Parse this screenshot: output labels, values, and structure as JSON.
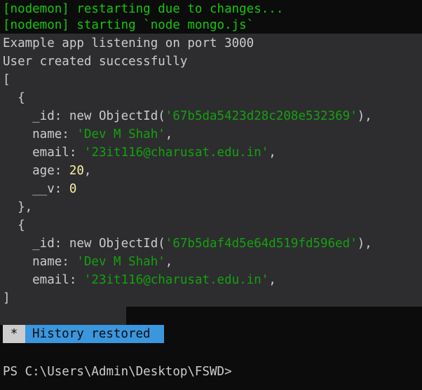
{
  "nodemon": {
    "restart": "[nodemon] restarting due to changes...",
    "start": "[nodemon] starting `node mongo.js`"
  },
  "output": {
    "listening": "Example app listening on port 3000",
    "created": "User created successfully",
    "open_bracket": "[",
    "close_bracket": "]",
    "docs": [
      {
        "open": "  {",
        "id_key": "    _id: new ObjectId(",
        "id_val": "'67b5da5423d28c208e532369'",
        "id_end": "),",
        "name_key": "    name: ",
        "name_val": "'Dev M Shah'",
        "email_key": "    email: ",
        "email_val": "'23it116@charusat.edu.in'",
        "age_key": "    age: ",
        "age_val": "20",
        "v_key": "    __v: ",
        "v_val": "0",
        "close": "  },"
      },
      {
        "open": "  {",
        "id_key": "    _id: new ObjectId(",
        "id_val": "'67b5daf4d5e64d519fd596ed'",
        "id_end": "),",
        "name_key": "    name: ",
        "name_val": "'Dev M Shah'",
        "email_key": "    email: ",
        "email_val": "'23it116@charusat.edu.in'"
      }
    ]
  },
  "history": {
    "star": "*",
    "label": "History restored"
  },
  "prompt": "PS C:\\Users\\Admin\\Desktop\\FSWD>",
  "colors": {
    "background": "#0c0c0c",
    "highlight": "#2d2d2f",
    "nodemon_green": "#16c60c",
    "string_green": "#13a10e",
    "number_yellow": "#f9f1a5",
    "badge_blue": "#3a96dd"
  }
}
